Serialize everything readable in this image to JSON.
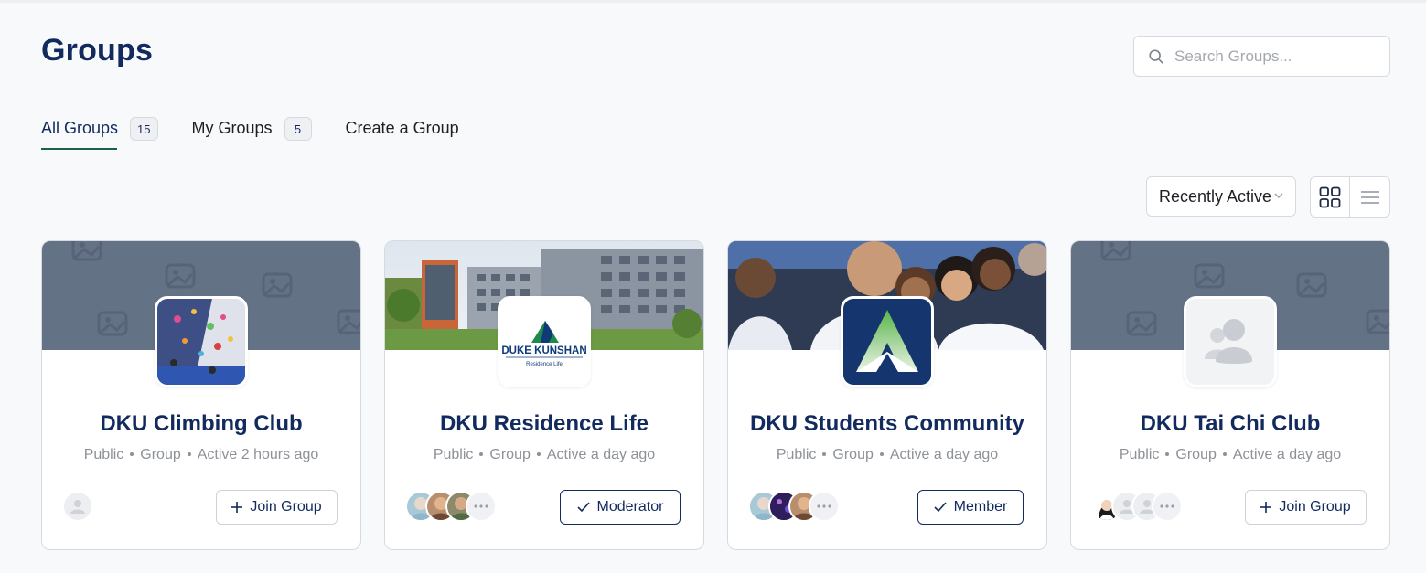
{
  "page": {
    "title": "Groups"
  },
  "search": {
    "placeholder": "Search Groups..."
  },
  "tabs": [
    {
      "label": "All Groups",
      "count": "15",
      "active": true
    },
    {
      "label": "My Groups",
      "count": "5",
      "active": false
    },
    {
      "label": "Create a Group",
      "active": false
    }
  ],
  "sort": {
    "selected": "Recently Active"
  },
  "view_toggle": {
    "options": [
      "grid-view-icon",
      "list-view-icon"
    ],
    "selected": "grid-view-icon"
  },
  "colors": {
    "brand_navy": "#122a5e",
    "active_tab_underline": "#1c6146",
    "cover_placeholder": "#647286"
  },
  "groups": [
    {
      "name": "DKU Climbing Club",
      "privacy": "Public",
      "type": "Group",
      "activity": "Active 2 hours ago",
      "action": "Join Group",
      "action_icon": "plus-icon"
    },
    {
      "name": "DKU Residence Life",
      "privacy": "Public",
      "type": "Group",
      "activity": "Active a day ago",
      "action": "Moderator",
      "action_icon": "check-icon",
      "logo_text": "DUKE KUNSHAN",
      "logo_subtext": "Residence Life"
    },
    {
      "name": "DKU Students Community",
      "privacy": "Public",
      "type": "Group",
      "activity": "Active a day ago",
      "action": "Member",
      "action_icon": "check-icon"
    },
    {
      "name": "DKU Tai Chi Club",
      "privacy": "Public",
      "type": "Group",
      "activity": "Active a day ago",
      "action": "Join Group",
      "action_icon": "plus-icon"
    }
  ]
}
